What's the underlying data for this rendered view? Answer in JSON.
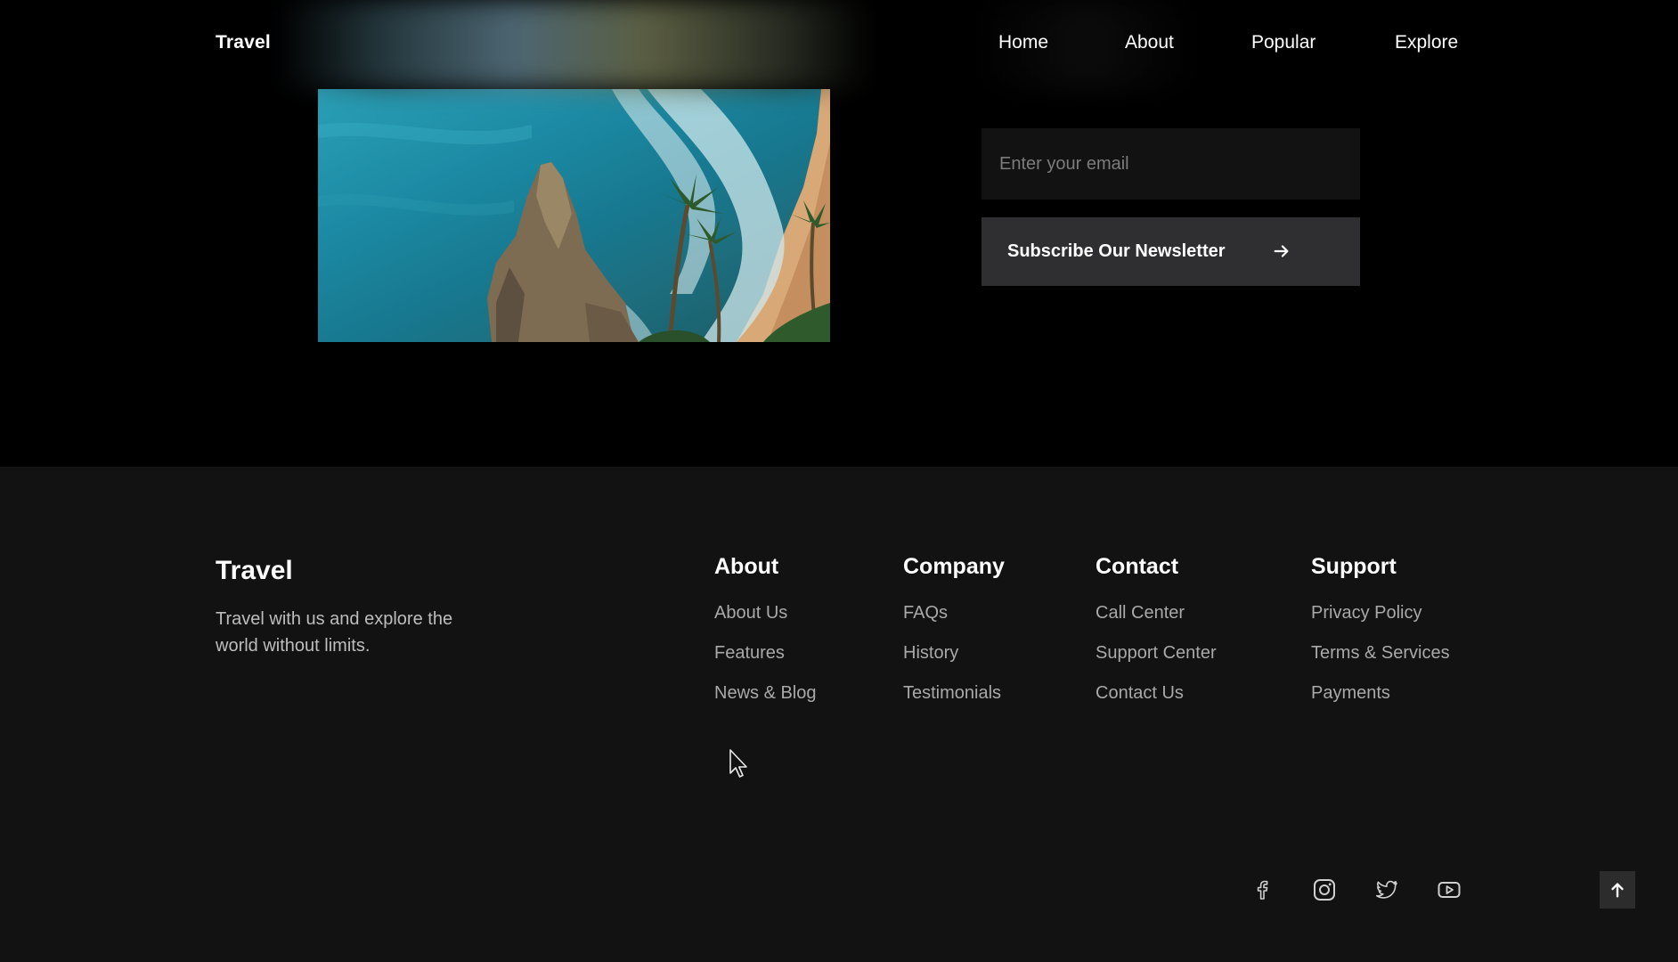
{
  "header": {
    "logo": "Travel",
    "nav": [
      {
        "label": "Home"
      },
      {
        "label": "About"
      },
      {
        "label": "Popular"
      },
      {
        "label": "Explore"
      }
    ]
  },
  "newsletter": {
    "email_placeholder": "Enter your email",
    "subscribe_label": "Subscribe Our Newsletter",
    "subscribe_icon": "arrow-right-icon"
  },
  "footer": {
    "brand": "Travel",
    "description": "Travel with us and explore the world without limits.",
    "columns": [
      {
        "title": "About",
        "links": [
          "About Us",
          "Features",
          "News & Blog"
        ]
      },
      {
        "title": "Company",
        "links": [
          "FAQs",
          "History",
          "Testimonials"
        ]
      },
      {
        "title": "Contact",
        "links": [
          "Call Center",
          "Support Center",
          "Contact Us"
        ]
      },
      {
        "title": "Support",
        "links": [
          "Privacy Policy",
          "Terms & Services",
          "Payments"
        ]
      }
    ],
    "social_icons": [
      "facebook-icon",
      "instagram-icon",
      "twitter-icon",
      "youtube-icon"
    ],
    "scroll_top_icon": "arrow-up-icon"
  },
  "colors": {
    "page_background": "#000000",
    "footer_background": "#121212",
    "input_background": "#121212",
    "button_background": "#2f2f31",
    "link_color": "#a9a9a9"
  }
}
